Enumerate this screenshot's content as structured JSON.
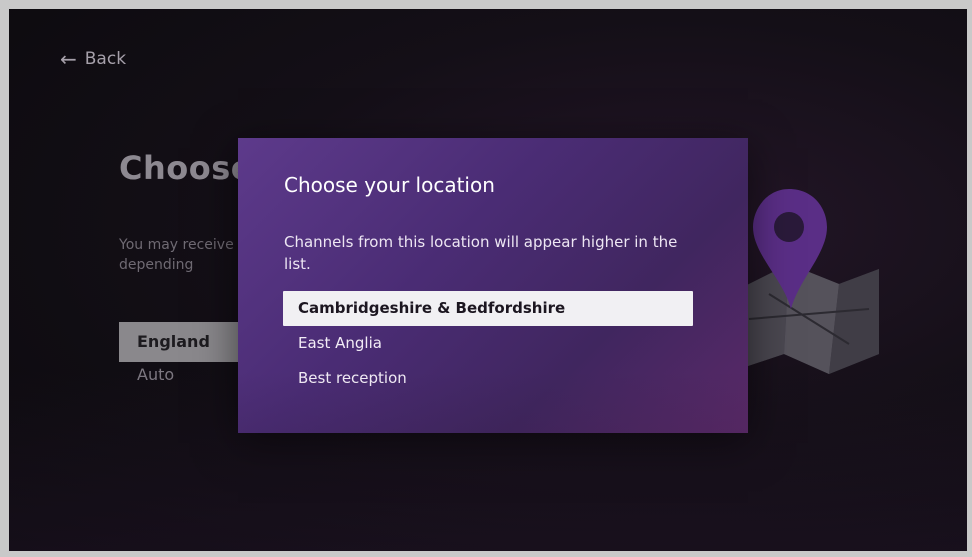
{
  "nav": {
    "back_label": "Back"
  },
  "background": {
    "title": "Choose",
    "description": "You may receive channels depending",
    "items": [
      {
        "label": "England",
        "selected": true
      },
      {
        "label": "Auto",
        "selected": false
      }
    ]
  },
  "dialog": {
    "title": "Choose your location",
    "description": "Channels from this location will appear higher in the list.",
    "options": [
      {
        "label": "Cambridgeshire & Bedfordshire",
        "focused": true
      },
      {
        "label": "East Anglia",
        "focused": false
      },
      {
        "label": "Best reception",
        "focused": false
      }
    ]
  },
  "colors": {
    "dialog_bg": "#4a2c74",
    "focus_bg": "#f1f0f3",
    "screen_bg": "#0b0a0d",
    "pin": "#5a2e86"
  },
  "icons": {
    "back": "arrow-left-icon",
    "illustration": "location-pin-map-icon"
  }
}
